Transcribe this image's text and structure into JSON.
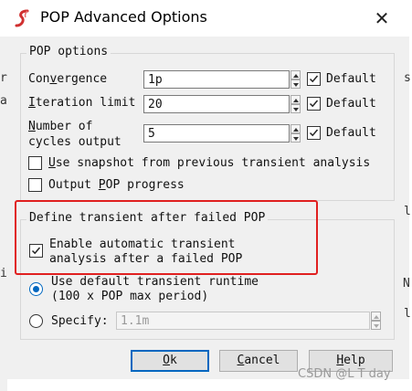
{
  "window": {
    "title": "POP Advanced Options",
    "close_glyph": "✕"
  },
  "background_edge": {
    "left_chars": [
      "r",
      "a",
      "",
      "i"
    ],
    "right_chars": [
      "s",
      "l",
      "N",
      "l"
    ]
  },
  "pop_options": {
    "legend": "POP options",
    "convergence": {
      "label_pre": "Con",
      "label_u": "v",
      "label_post": "ergence",
      "value": "1p",
      "default_label": "Default",
      "default_checked": true
    },
    "iteration_limit": {
      "label_u": "I",
      "label_post": "teration limit",
      "value": "20",
      "default_label": "Default",
      "default_checked": true
    },
    "cycles_output": {
      "label_u": "N",
      "label_line1_post": "umber of",
      "label_line2": "cycles output",
      "value": "5",
      "default_label": "Default",
      "default_checked": true
    },
    "use_snapshot": {
      "label_u": "U",
      "label_post": "se snapshot from previous transient analysis",
      "checked": false
    },
    "output_progress": {
      "label_pre": "Output ",
      "label_u": "P",
      "label_post": "OP progress",
      "checked": false
    }
  },
  "transient": {
    "legend": "Define transient after failed POP",
    "enable_auto": {
      "line1": "Enable automatic transient",
      "line2": "analysis after a failed POP",
      "checked": true
    },
    "use_default": {
      "line1": "Use default transient runtime",
      "line2": "(100 x POP max period)",
      "selected": true
    },
    "specify": {
      "label": "Specify:",
      "value": "1.1m",
      "selected": false
    }
  },
  "buttons": {
    "ok": {
      "u": "O",
      "post": "k"
    },
    "cancel": {
      "pre": "",
      "u": "C",
      "post": "ancel"
    },
    "help": {
      "u": "H",
      "post": "elp"
    }
  },
  "watermark": "CSDN @L T day",
  "colors": {
    "highlight": "#e02020",
    "accent": "#0067c0",
    "logo": "#d03030"
  }
}
